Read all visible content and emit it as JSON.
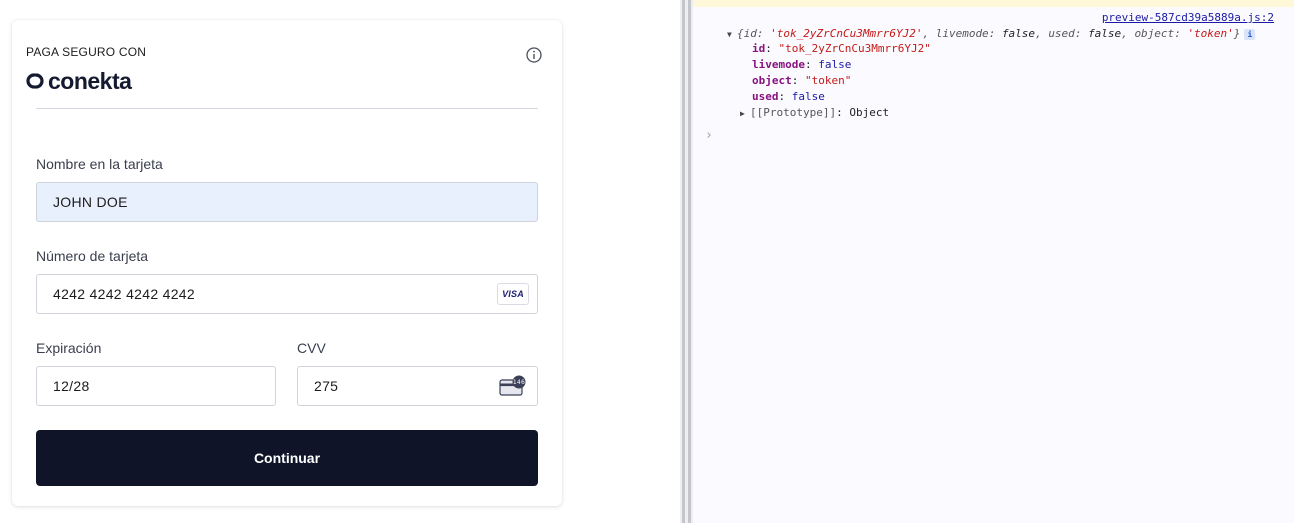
{
  "checkout": {
    "pay_label": "PAGA SEGURO CON",
    "brand": "conekta",
    "name_label": "Nombre en la tarjeta",
    "name_value": "JOHN DOE",
    "card_label": "Número de tarjeta",
    "card_value": "4242 4242 4242 4242",
    "card_brand": "VISA",
    "exp_label": "Expiración",
    "exp_value": "12/28",
    "cvv_label": "CVV",
    "cvv_value": "275",
    "cvv_hint": "146",
    "submit_label": "Continuar",
    "colors": {
      "button": "#0f1428",
      "autofill": "#e8f0fe",
      "brand_text": "#151a30"
    }
  },
  "console": {
    "source": "preview-587cd39a5889a.js:2",
    "summary": {
      "open": "{",
      "id_key": "id",
      "id_val": "'tok_2yZrCnCu3Mmrr6YJ2'",
      "livemode_key": "livemode",
      "livemode_val": "false",
      "used_key": "used",
      "used_val": "false",
      "object_key": "object",
      "object_val": "'token'",
      "close": "}"
    },
    "props": [
      {
        "key": "id",
        "value": "\"tok_2yZrCnCu3Mmrr6YJ2\"",
        "kind": "string"
      },
      {
        "key": "livemode",
        "value": "false",
        "kind": "bool"
      },
      {
        "key": "object",
        "value": "\"token\"",
        "kind": "string"
      },
      {
        "key": "used",
        "value": "false",
        "kind": "bool"
      }
    ],
    "prototype_key": "[[Prototype]]",
    "prototype_val": "Object"
  }
}
